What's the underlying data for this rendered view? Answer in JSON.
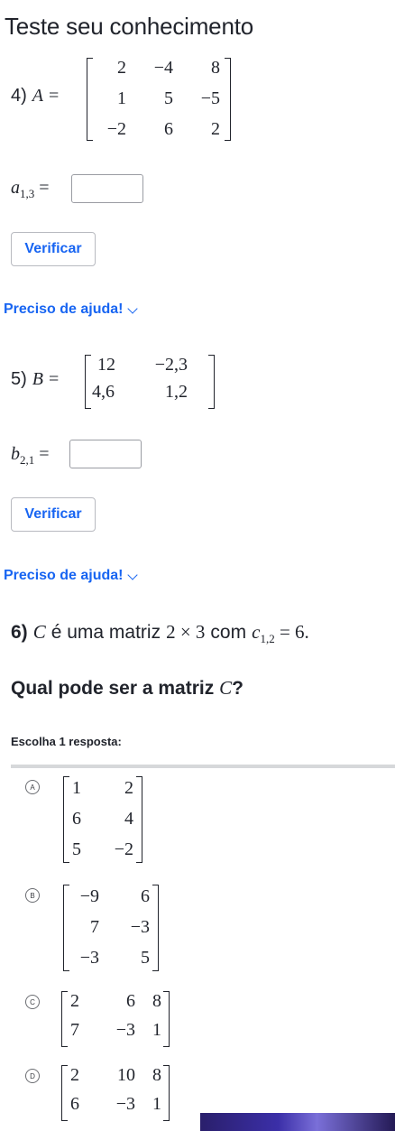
{
  "page": {
    "title": "Teste seu conhecimento"
  },
  "q4": {
    "number": "4)",
    "var": "A",
    "matrix": [
      [
        "2",
        "−4",
        "8"
      ],
      [
        "1",
        "5",
        "−5"
      ],
      [
        "−2",
        "6",
        "2"
      ]
    ],
    "answer_label": "a",
    "answer_sub": "1,3",
    "verify": "Verificar",
    "help": "Preciso de ajuda!"
  },
  "q5": {
    "number": "5)",
    "var": "B",
    "matrix": [
      [
        "12",
        "−2,3"
      ],
      [
        "4,6",
        "1,2"
      ]
    ],
    "answer_label": "b",
    "answer_sub": "2,1",
    "verify": "Verificar",
    "help": "Preciso de ajuda!"
  },
  "q6": {
    "number": "6)",
    "var": "C",
    "text1": "é uma matriz",
    "dims": "2 × 3",
    "text2": "com",
    "cvar": "c",
    "csub": "1,2",
    "cval": "= 6.",
    "question_prefix": "Qual pode ser a matriz",
    "question_var": "C",
    "question_suffix": "?",
    "choose": "Escolha 1 resposta:",
    "choices": [
      {
        "letter": "A",
        "matrix": [
          [
            "1",
            "2"
          ],
          [
            "6",
            "4"
          ],
          [
            "5",
            "−2"
          ]
        ]
      },
      {
        "letter": "B",
        "matrix": [
          [
            "−9",
            "6"
          ],
          [
            "7",
            "−3"
          ],
          [
            "−3",
            "5"
          ]
        ]
      },
      {
        "letter": "C",
        "matrix": [
          [
            "2",
            "6",
            "8"
          ],
          [
            "7",
            "−3",
            "1"
          ]
        ]
      },
      {
        "letter": "D",
        "matrix": [
          [
            "2",
            "10",
            "8"
          ],
          [
            "6",
            "−3",
            "1"
          ]
        ]
      }
    ]
  }
}
